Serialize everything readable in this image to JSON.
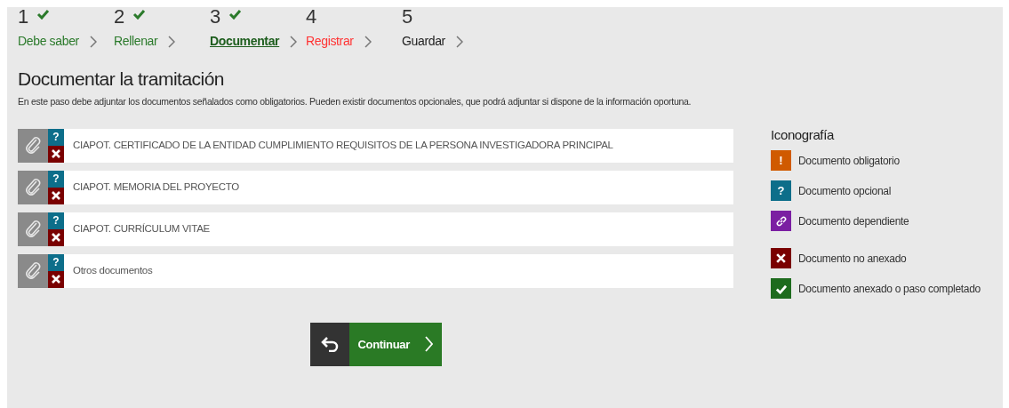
{
  "steps": [
    {
      "number": "1",
      "label": "Debe saber",
      "kind": "done",
      "checked": true
    },
    {
      "number": "2",
      "label": "Rellenar",
      "kind": "done",
      "checked": true
    },
    {
      "number": "3",
      "label": "Documentar",
      "kind": "current",
      "checked": true
    },
    {
      "number": "4",
      "label": "Registrar",
      "kind": "error",
      "checked": false
    },
    {
      "number": "5",
      "label": "Guardar",
      "kind": "pending",
      "checked": false
    }
  ],
  "heading": "Documentar la tramitación",
  "description": "En este paso debe adjuntar los documentos señalados como obligatorios. Pueden existir documentos opcionales, que podrá adjuntar si dispone de la información oportuna.",
  "documents": [
    {
      "title": "CIAPOT. CERTIFICADO DE LA ENTIDAD CUMPLIMIENTO REQUISITOS DE LA PERSONA INVESTIGADORA PRINCIPAL",
      "kind": "optional",
      "symbol": "?",
      "attached": false
    },
    {
      "title": "CIAPOT. MEMORIA DEL PROYECTO",
      "kind": "optional",
      "symbol": "?",
      "attached": false
    },
    {
      "title": "CIAPOT. CURRÍCULUM VITAE",
      "kind": "optional",
      "symbol": "?",
      "attached": false
    },
    {
      "title": "Otros documentos",
      "kind": "optional",
      "symbol": "?",
      "attached": false
    }
  ],
  "legend": {
    "title": "Iconografía",
    "items": [
      {
        "kind": "mandatory",
        "symbol": "!",
        "label": "Documento obligatorio"
      },
      {
        "kind": "optional",
        "symbol": "?",
        "label": "Documento opcional"
      },
      {
        "kind": "dependent",
        "label": "Documento dependiente"
      },
      {
        "kind": "not_attached",
        "label": "Documento no anexado"
      },
      {
        "kind": "attached",
        "label": "Documento anexado o paso completado"
      }
    ]
  },
  "continue_button": "Continuar"
}
